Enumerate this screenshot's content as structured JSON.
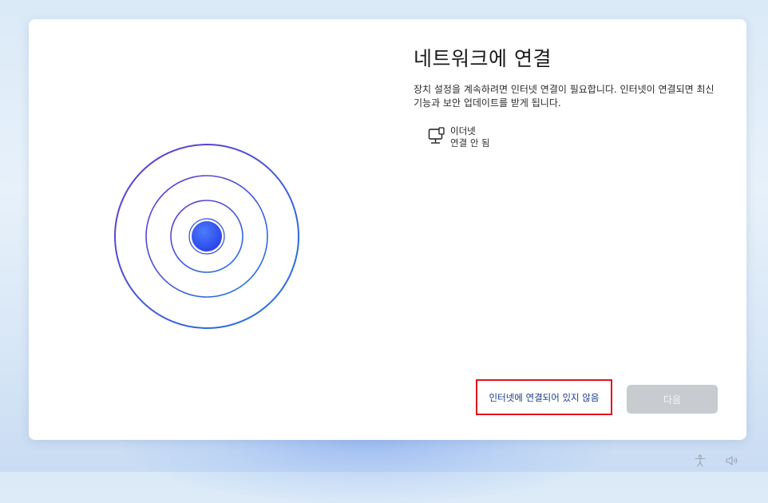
{
  "page": {
    "title": "네트워크에 연결",
    "description": "장치 설정을 계속하려면 인터넷 연결이 필요합니다. 인터넷이 연결되면 최신 기능과 보안 업데이트를 받게 됩니다."
  },
  "network": {
    "icon": "ethernet-icon",
    "name": "이더넷",
    "status": "연결 안 됨"
  },
  "actions": {
    "no_internet_label": "인터넷에 연결되어 있지 않음",
    "next_label": "다음"
  },
  "tray": {
    "accessibility_icon": "accessibility-icon",
    "volume_icon": "volume-icon"
  },
  "colors": {
    "ring_purple": "#5b3fd6",
    "ring_blue": "#1f6fe0",
    "dot": "#2b5cf5",
    "highlight_border": "#e0141e",
    "link_text": "#1a3c8c",
    "button_disabled": "#c8cbd0"
  }
}
